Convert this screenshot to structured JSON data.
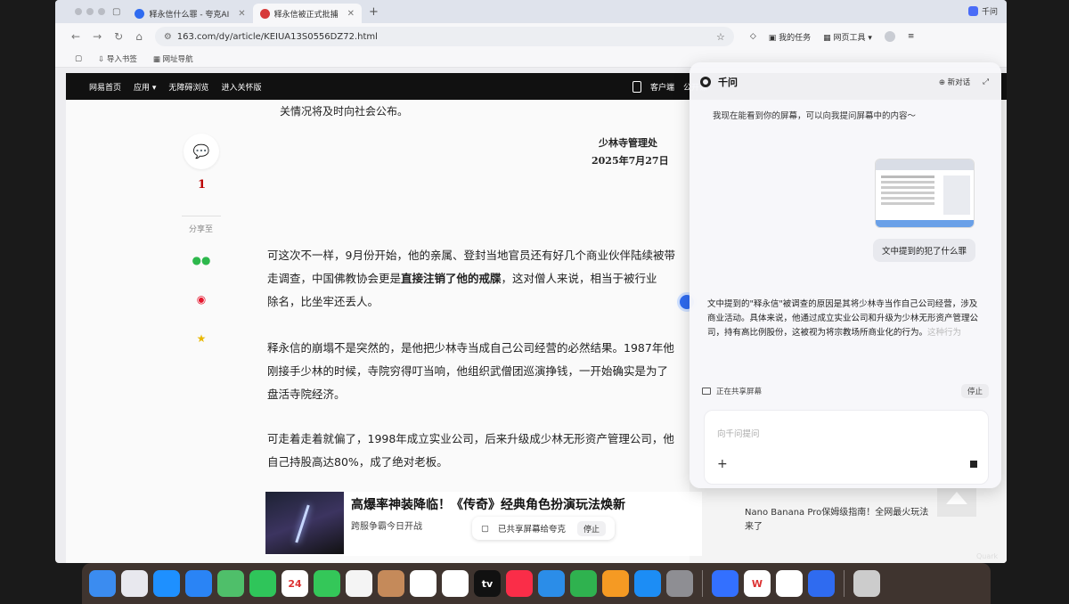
{
  "tabs": [
    {
      "label": "释永信什么罪 - 夸克AI",
      "color": "#2f6bf0",
      "active": false
    },
    {
      "label": "释永信被正式批捕",
      "color": "#d63a3a",
      "active": true
    }
  ],
  "new_tab": "+",
  "top_right_app": "千问",
  "url": "163.com/dy/article/KEIUA13S0556DZ72.html",
  "toolbar": {
    "tasks": "我的任务",
    "tools": "网页工具"
  },
  "bookmarks": [
    "导入书签",
    "网址导航"
  ],
  "site_nav": {
    "home": "网易首页",
    "apps": "应用",
    "accessible": "无障碍浏览",
    "care": "进入关怀版",
    "right1": "客户端",
    "right2": "公开课"
  },
  "article": {
    "prev_line": "关情况将及时向社会公布。",
    "sign_org": "少林寺管理处",
    "sign_date": "2025年7月27日",
    "comment_count": "1",
    "share_label": "分享至",
    "p1_pre": "可这次不一样，9月份开始，他的亲属、登封当地官员还有好几个商业伙伴陆续被带走调查，中国佛教协会更是",
    "p1_bold": "直接注销了他的戒牒",
    "p1_post": "，这对僧人来说，相当于被行业",
    "p1_end": "除名，比坐牢还丢人。",
    "p2": "释永信的崩塌不是突然的，是他把少林寺当成自己公司经营的必然结果。1987年他刚接手少林的时候，寺院穷得叮当响，他组织武僧团巡演挣钱，一开始确实是为了盘活寺院经济。",
    "p3": "可走着走着就偏了，1998年成立实业公司，后来升级成少林无形资产管理公司，他自己持股高达80%，成了绝对老板。",
    "ad_title": "高爆率神装降临！《传奇》经典角色扮演玩法焕新",
    "ad_sub": "跨服争霸今日开战"
  },
  "share_pill": {
    "text": "已共享屏幕给夸克",
    "stop": "停止"
  },
  "right_col": {
    "top_text": "",
    "promo": "Nano Banana Pro保姆级指南！全网最火玩法来了"
  },
  "assistant": {
    "title": "千问",
    "new_chat": "新对话",
    "greeting": "我现在能看到你的屏幕，可以向我提问屏幕中的内容～",
    "user_question": "文中提到的犯了什么罪",
    "answer": "文中提到的\"释永信\"被调查的原因是其将少林寺当作自己公司经营，涉及商业活动。具体来说，他通过成立实业公司和升级为少林无形资产管理公司，持有高比例股份，这被视为将宗教场所商业化的行为。",
    "answer_fade": "这种行为",
    "sharing": "正在共享屏幕",
    "stop": "停止",
    "input_placeholder": "向千问提问"
  },
  "dock_apps": [
    {
      "icon": "finder-icon",
      "bg": "#3b8cf0",
      "label": ""
    },
    {
      "icon": "launchpad-icon",
      "bg": "#e8e8ee",
      "label": ""
    },
    {
      "icon": "safari-icon",
      "bg": "#1e90ff",
      "label": ""
    },
    {
      "icon": "mail-icon",
      "bg": "#2a84f5",
      "label": ""
    },
    {
      "icon": "maps-icon",
      "bg": "#4fbf6a",
      "label": ""
    },
    {
      "icon": "facetime-icon",
      "bg": "#2fc55a",
      "label": ""
    },
    {
      "icon": "calendar-icon",
      "bg": "#ffffff",
      "label": "24"
    },
    {
      "icon": "messages-icon",
      "bg": "#34c759",
      "label": ""
    },
    {
      "icon": "photos-icon",
      "bg": "#f4f4f4",
      "label": ""
    },
    {
      "icon": "contacts-icon",
      "bg": "#c58a5a",
      "label": ""
    },
    {
      "icon": "reminders-icon",
      "bg": "#ffffff",
      "label": ""
    },
    {
      "icon": "freeform-icon",
      "bg": "#ffffff",
      "label": ""
    },
    {
      "icon": "tv-icon",
      "bg": "#111111",
      "label": "tv"
    },
    {
      "icon": "music-icon",
      "bg": "#fa2d48",
      "label": ""
    },
    {
      "icon": "keynote-icon",
      "bg": "#2b8de8",
      "label": ""
    },
    {
      "icon": "numbers-icon",
      "bg": "#2fb24f",
      "label": ""
    },
    {
      "icon": "pages-icon",
      "bg": "#f59a23",
      "label": ""
    },
    {
      "icon": "appstore-icon",
      "bg": "#1c8df5",
      "label": ""
    },
    {
      "icon": "settings-icon",
      "bg": "#8e8e93",
      "label": ""
    },
    {
      "icon": "feishu-icon",
      "bg": "#3370ff",
      "label": ""
    },
    {
      "icon": "wps-icon",
      "bg": "#ffffff",
      "label": "W"
    },
    {
      "icon": "quark-app-icon",
      "bg": "#ffffff",
      "label": ""
    },
    {
      "icon": "qwen-app-icon",
      "bg": "#2f6bf0",
      "label": ""
    }
  ],
  "watermark": "Quark"
}
